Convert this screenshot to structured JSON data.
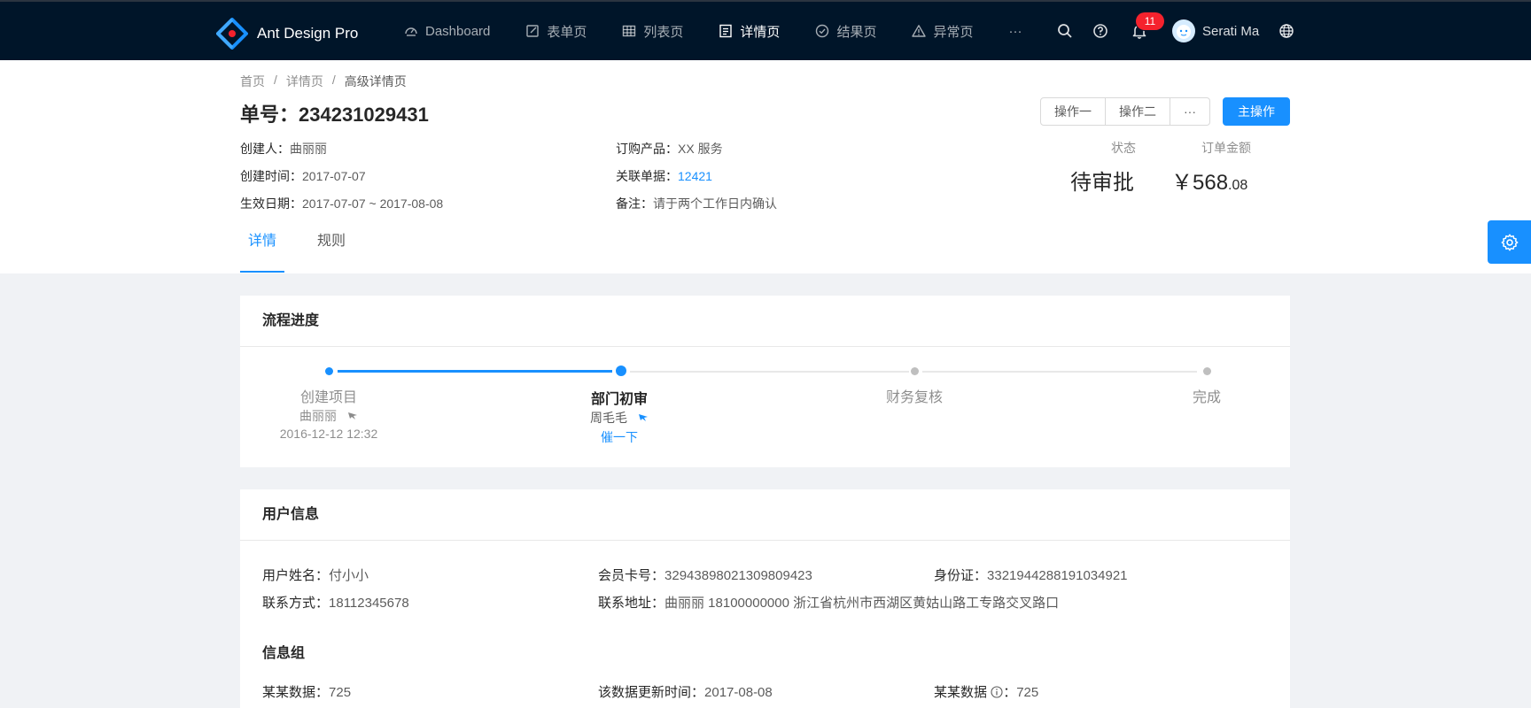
{
  "app": {
    "title": "Ant Design Pro"
  },
  "nav": {
    "items": [
      {
        "label": "Dashboard",
        "icon": "dashboard-icon"
      },
      {
        "label": "表单页",
        "icon": "form-icon"
      },
      {
        "label": "列表页",
        "icon": "table-icon"
      },
      {
        "label": "详情页",
        "icon": "profile-icon"
      },
      {
        "label": "结果页",
        "icon": "check-circle-icon"
      },
      {
        "label": "异常页",
        "icon": "warning-icon"
      }
    ],
    "more": "···",
    "notification_count": "11",
    "user_name": "Serati Ma"
  },
  "breadcrumb": [
    "首页",
    "详情页",
    "高级详情页"
  ],
  "header": {
    "title": "单号：234231029431",
    "actions": [
      "操作一",
      "操作二",
      "···"
    ],
    "primary_action": "主操作",
    "fields": {
      "creator_label": "创建人：",
      "creator": "曲丽丽",
      "product_label": "订购产品：",
      "product": "XX 服务",
      "created_label": "创建时间：",
      "created": "2017-07-07",
      "ref_label": "关联单据：",
      "ref": "12421",
      "effective_label": "生效日期：",
      "effective": "2017-07-07 ~ 2017-08-08",
      "remark_label": "备注：",
      "remark": "请于两个工作日内确认"
    },
    "status_label": "状态",
    "status": "待审批",
    "amount_label": "订单金额",
    "amount_main": "￥568",
    "amount_cents": ".08"
  },
  "tabs": [
    "详情",
    "规则"
  ],
  "progress": {
    "title": "流程进度",
    "steps": [
      {
        "title": "创建项目",
        "person": "曲丽丽",
        "time": "2016-12-12 12:32"
      },
      {
        "title": "部门初审",
        "person": "周毛毛",
        "action": "催一下"
      },
      {
        "title": "财务复核"
      },
      {
        "title": "完成"
      }
    ]
  },
  "user_info": {
    "title": "用户信息",
    "name_label": "用户姓名：",
    "name": "付小小",
    "member_label": "会员卡号：",
    "member": "32943898021309809423",
    "id_label": "身份证：",
    "id": "3321944288191034921",
    "phone_label": "联系方式：",
    "phone": "18112345678",
    "address_label": "联系地址：",
    "address": "曲丽丽 18100000000 浙江省杭州市西湖区黄姑山路工专路交叉路口",
    "group_title": "信息组",
    "data1_label": "某某数据：",
    "data1": "725",
    "updated_label": "该数据更新时间：",
    "updated": "2017-08-08",
    "data2_label": "某某数据",
    "data2_colon": "：",
    "data2": "725"
  },
  "colors": {
    "nav_bg": "#001529",
    "primary": "#1890ff",
    "page_bg": "#f0f2f5"
  }
}
